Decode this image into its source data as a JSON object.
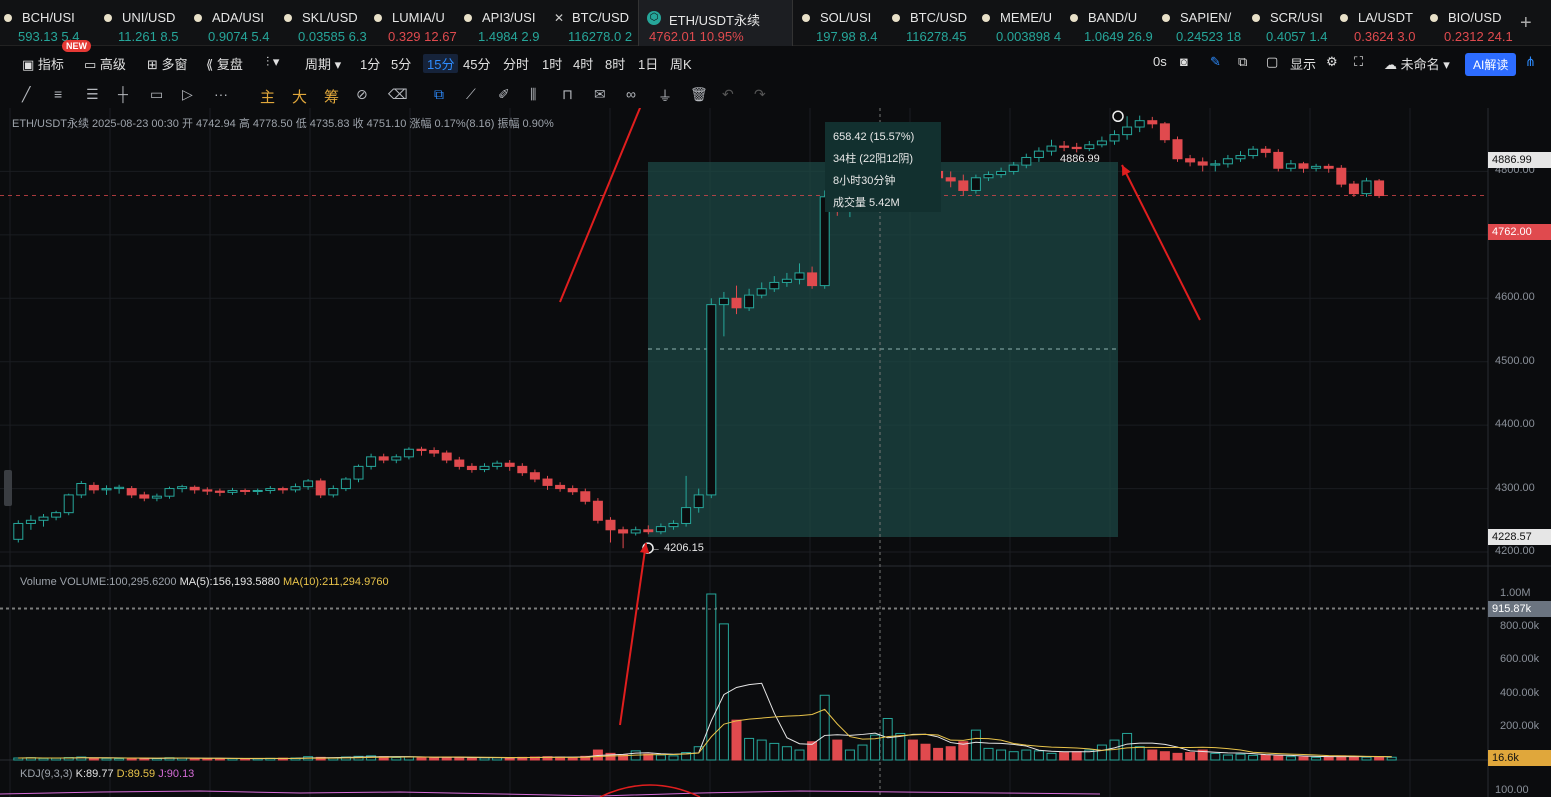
{
  "tickers": [
    {
      "symbol": "BCH/USI",
      "price": "593.13",
      "change": "5.4",
      "dir": "up"
    },
    {
      "symbol": "UNI/USD",
      "price": "11.261",
      "change": "8.5",
      "dir": "up"
    },
    {
      "symbol": "ADA/USI",
      "price": "0.9074",
      "change": "5.4",
      "dir": "up"
    },
    {
      "symbol": "SKL/USD",
      "price": "0.03585",
      "change": "6.3",
      "dir": "up"
    },
    {
      "symbol": "LUMIA/U",
      "price": "0.329",
      "change": "12.67",
      "dir": "down"
    },
    {
      "symbol": "API3/USI",
      "price": "1.4984",
      "change": "2.9",
      "dir": "up"
    },
    {
      "symbol": "BTC/USD",
      "price": "116278.0",
      "change": "2",
      "dir": "up"
    },
    {
      "symbol": "ETH/USDT永续",
      "price": "4762.01",
      "change": "10.95%",
      "dir": "down",
      "active": true
    },
    {
      "symbol": "SOL/USI",
      "price": "197.98",
      "change": "8.4",
      "dir": "up"
    },
    {
      "symbol": "BTC/USD",
      "price": "116278.45",
      "change": "",
      "dir": "up"
    },
    {
      "symbol": "MEME/U",
      "price": "0.003898",
      "change": "4",
      "dir": "up"
    },
    {
      "symbol": "BAND/U",
      "price": "1.0649",
      "change": "26.9",
      "dir": "up"
    },
    {
      "symbol": "SAPIEN/",
      "price": "0.24523",
      "change": "18",
      "dir": "up"
    },
    {
      "symbol": "SCR/USI",
      "price": "0.4057",
      "change": "1.4",
      "dir": "up"
    },
    {
      "symbol": "LA/USDT",
      "price": "0.3624",
      "change": "3.0",
      "dir": "down"
    },
    {
      "symbol": "BIO/USD",
      "price": "0.2312",
      "change": "24.1",
      "dir": "down"
    }
  ],
  "new_badge": "NEW",
  "toolbar1": {
    "indicators": "指标",
    "advanced": "高级",
    "multi_window": "多窗",
    "replay": "复盘",
    "period": "周期",
    "intervals": [
      "1分",
      "5分",
      "15分",
      "45分",
      "分时",
      "1时",
      "4时",
      "8时",
      "1日",
      "周K"
    ],
    "selected_interval": "15分",
    "timer": "0s",
    "display": "显示",
    "unnamed": "未命名",
    "ai": "AI解读"
  },
  "toolbar2": {
    "chars": [
      "主",
      "大",
      "筹"
    ]
  },
  "info_line": "ETH/USDT永续  2025-08-23 00:30  开 4742.94  高 4778.50  低 4735.83  收 4751.10  涨幅 0.17%(8.16)  振幅 0.90%",
  "volume_line": {
    "prefix": "Volume  VOLUME:100,295.6200",
    "ma5": "MA(5):156,193.5880",
    "ma10": "MA(10):211,294.9760"
  },
  "kdj_line": {
    "label": "KDJ(9,3,3)",
    "k": "K:89.77",
    "d": "D:89.59",
    "j": "J:90.13"
  },
  "measure": {
    "line1": "658.42 (15.57%)",
    "line2": "34柱 (22阳12阴)",
    "line3": "8小时30分钟",
    "line4": "成交量 5.42M"
  },
  "labels": {
    "high": "4886.99",
    "low": "← 4206.15"
  },
  "price_axis": [
    "4800.00",
    "4700.00",
    "4600.00",
    "4500.00",
    "4400.00",
    "4300.00",
    "4200.00"
  ],
  "price_tags": {
    "high": "4886.99",
    "current": "4762.00",
    "low": "4228.57"
  },
  "volume_axis": [
    "1.00M",
    "800.00k",
    "600.00k",
    "400.00k",
    "200.00k"
  ],
  "volume_tags": {
    "crosshair": "915.87k",
    "current": "16.6k"
  },
  "kdj_axis": [
    "100.00"
  ],
  "colors": {
    "up": "#26a69a",
    "down": "#e04a4e",
    "accent": "#2d8cff",
    "arrow": "#e01e1e"
  },
  "chart_data": {
    "type": "candlestick",
    "title": "ETH/USDT永续",
    "interval": "15分",
    "ylim": [
      4200,
      4900
    ],
    "candles": [
      [
        4220,
        4245,
        4215,
        4250
      ],
      [
        4245,
        4250,
        4235,
        4258
      ],
      [
        4250,
        4255,
        4240,
        4260
      ],
      [
        4255,
        4262,
        4250,
        4265
      ],
      [
        4262,
        4290,
        4258,
        4292
      ],
      [
        4290,
        4308,
        4285,
        4312
      ],
      [
        4305,
        4298,
        4292,
        4310
      ],
      [
        4298,
        4300,
        4290,
        4305
      ],
      [
        4300,
        4302,
        4292,
        4306
      ],
      [
        4300,
        4290,
        4285,
        4304
      ],
      [
        4290,
        4285,
        4280,
        4295
      ],
      [
        4285,
        4288,
        4280,
        4292
      ],
      [
        4288,
        4300,
        4284,
        4303
      ],
      [
        4300,
        4303,
        4294,
        4306
      ],
      [
        4302,
        4298,
        4292,
        4305
      ],
      [
        4298,
        4296,
        4290,
        4302
      ],
      [
        4296,
        4294,
        4288,
        4300
      ],
      [
        4294,
        4297,
        4290,
        4301
      ],
      [
        4297,
        4296,
        4290,
        4300
      ],
      [
        4296,
        4297,
        4290,
        4300
      ],
      [
        4297,
        4300,
        4292,
        4304
      ],
      [
        4300,
        4298,
        4292,
        4303
      ],
      [
        4298,
        4303,
        4294,
        4308
      ],
      [
        4303,
        4312,
        4298,
        4315
      ],
      [
        4312,
        4290,
        4285,
        4316
      ],
      [
        4290,
        4300,
        4286,
        4305
      ],
      [
        4300,
        4315,
        4296,
        4318
      ],
      [
        4315,
        4335,
        4310,
        4338
      ],
      [
        4335,
        4350,
        4330,
        4355
      ],
      [
        4350,
        4345,
        4340,
        4355
      ],
      [
        4345,
        4350,
        4340,
        4354
      ],
      [
        4350,
        4362,
        4346,
        4365
      ],
      [
        4362,
        4360,
        4352,
        4366
      ],
      [
        4360,
        4356,
        4350,
        4365
      ],
      [
        4356,
        4345,
        4340,
        4360
      ],
      [
        4345,
        4335,
        4330,
        4350
      ],
      [
        4335,
        4330,
        4325,
        4340
      ],
      [
        4330,
        4335,
        4326,
        4340
      ],
      [
        4335,
        4340,
        4330,
        4344
      ],
      [
        4340,
        4335,
        4328,
        4345
      ],
      [
        4335,
        4325,
        4320,
        4340
      ],
      [
        4325,
        4315,
        4310,
        4330
      ],
      [
        4315,
        4305,
        4298,
        4320
      ],
      [
        4305,
        4300,
        4295,
        4310
      ],
      [
        4300,
        4295,
        4290,
        4305
      ],
      [
        4295,
        4280,
        4275,
        4300
      ],
      [
        4280,
        4250,
        4245,
        4285
      ],
      [
        4250,
        4235,
        4215,
        4255
      ],
      [
        4235,
        4230,
        4206,
        4240
      ],
      [
        4230,
        4235,
        4226,
        4240
      ],
      [
        4235,
        4232,
        4228,
        4242
      ],
      [
        4232,
        4240,
        4228,
        4245
      ],
      [
        4240,
        4245,
        4235,
        4250
      ],
      [
        4245,
        4270,
        4240,
        4320
      ],
      [
        4270,
        4290,
        4262,
        4300
      ],
      [
        4290,
        4590,
        4285,
        4600
      ],
      [
        4590,
        4600,
        4540,
        4610
      ],
      [
        4600,
        4585,
        4575,
        4620
      ],
      [
        4585,
        4605,
        4580,
        4615
      ],
      [
        4605,
        4615,
        4600,
        4625
      ],
      [
        4615,
        4625,
        4610,
        4635
      ],
      [
        4625,
        4630,
        4618,
        4640
      ],
      [
        4630,
        4640,
        4622,
        4655
      ],
      [
        4640,
        4620,
        4615,
        4650
      ],
      [
        4620,
        4760,
        4615,
        4770
      ],
      [
        4760,
        4740,
        4730,
        4765
      ],
      [
        4740,
        4745,
        4728,
        4755
      ],
      [
        4745,
        4750,
        4738,
        4770
      ],
      [
        4750,
        4760,
        4745,
        4800
      ],
      [
        4760,
        4830,
        4755,
        4840
      ],
      [
        4830,
        4845,
        4820,
        4855
      ],
      [
        4845,
        4815,
        4808,
        4850
      ],
      [
        4815,
        4800,
        4792,
        4820
      ],
      [
        4800,
        4790,
        4785,
        4808
      ],
      [
        4790,
        4785,
        4775,
        4800
      ],
      [
        4785,
        4770,
        4762,
        4795
      ],
      [
        4770,
        4790,
        4765,
        4795
      ],
      [
        4790,
        4795,
        4785,
        4800
      ],
      [
        4795,
        4800,
        4790,
        4806
      ],
      [
        4800,
        4810,
        4795,
        4815
      ],
      [
        4810,
        4822,
        4805,
        4828
      ],
      [
        4822,
        4832,
        4815,
        4838
      ],
      [
        4832,
        4840,
        4825,
        4850
      ],
      [
        4840,
        4838,
        4832,
        4848
      ],
      [
        4838,
        4836,
        4830,
        4845
      ],
      [
        4836,
        4842,
        4832,
        4848
      ],
      [
        4842,
        4848,
        4838,
        4855
      ],
      [
        4848,
        4858,
        4842,
        4865
      ],
      [
        4858,
        4870,
        4850,
        4887
      ],
      [
        4870,
        4880,
        4862,
        4888
      ],
      [
        4880,
        4875,
        4868,
        4886
      ],
      [
        4875,
        4850,
        4845,
        4878
      ],
      [
        4850,
        4820,
        4815,
        4855
      ],
      [
        4820,
        4815,
        4808,
        4826
      ],
      [
        4815,
        4810,
        4800,
        4822
      ],
      [
        4810,
        4812,
        4800,
        4818
      ],
      [
        4812,
        4820,
        4806,
        4826
      ],
      [
        4820,
        4825,
        4815,
        4832
      ],
      [
        4825,
        4835,
        4820,
        4840
      ],
      [
        4835,
        4830,
        4822,
        4840
      ],
      [
        4830,
        4805,
        4800,
        4835
      ],
      [
        4805,
        4812,
        4800,
        4818
      ],
      [
        4812,
        4805,
        4798,
        4815
      ],
      [
        4805,
        4808,
        4800,
        4812
      ],
      [
        4808,
        4805,
        4798,
        4812
      ],
      [
        4805,
        4780,
        4775,
        4810
      ],
      [
        4780,
        4765,
        4760,
        4785
      ],
      [
        4765,
        4785,
        4760,
        4790
      ],
      [
        4785,
        4762,
        4758,
        4788
      ]
    ],
    "volumes": [
      12000,
      14000,
      10000,
      11000,
      15000,
      18000,
      12000,
      10000,
      9000,
      11000,
      10000,
      9000,
      14000,
      12000,
      10000,
      9000,
      8000,
      9000,
      8000,
      9000,
      10000,
      11000,
      12000,
      20000,
      16000,
      12000,
      18000,
      22000,
      25000,
      20000,
      15000,
      18000,
      16000,
      14000,
      18000,
      15000,
      12000,
      13000,
      14000,
      15000,
      16000,
      18000,
      20000,
      18000,
      16000,
      22000,
      60000,
      40000,
      30000,
      55000,
      35000,
      30000,
      25000,
      45000,
      80000,
      1000000,
      820000,
      240000,
      130000,
      120000,
      100000,
      80000,
      60000,
      110000,
      390000,
      120000,
      60000,
      90000,
      150000,
      250000,
      160000,
      120000,
      95000,
      70000,
      80000,
      110000,
      180000,
      70000,
      60000,
      50000,
      60000,
      55000,
      40000,
      45000,
      50000,
      60000,
      90000,
      120000,
      160000,
      80000,
      60000,
      50000,
      40000,
      45000,
      60000,
      40000,
      30000,
      35000,
      28000,
      30000,
      25000,
      20000,
      18000,
      16000,
      22000,
      25000,
      20000,
      17000,
      18000,
      16600
    ]
  }
}
